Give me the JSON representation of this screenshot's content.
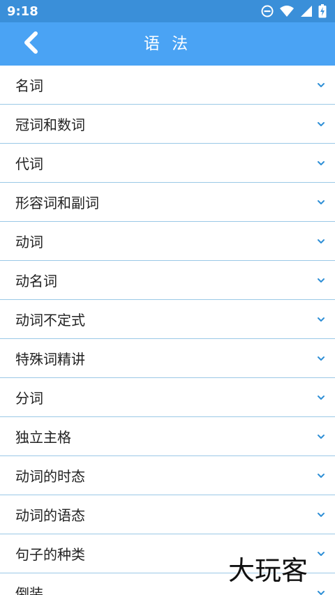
{
  "status_bar": {
    "time": "9:18",
    "icons": [
      "do-not-disturb-icon",
      "wifi-icon",
      "cellular-signal-icon",
      "battery-charging-icon"
    ]
  },
  "app_bar": {
    "title": "语 法",
    "back_icon": "chevron-left-icon"
  },
  "list": {
    "items": [
      {
        "label": "名词"
      },
      {
        "label": "冠词和数词"
      },
      {
        "label": "代词"
      },
      {
        "label": "形容词和副词"
      },
      {
        "label": "动词"
      },
      {
        "label": "动名词"
      },
      {
        "label": "动词不定式"
      },
      {
        "label": "特殊词精讲"
      },
      {
        "label": "分词"
      },
      {
        "label": "独立主格"
      },
      {
        "label": "动词的时态"
      },
      {
        "label": "动词的语态"
      },
      {
        "label": "句子的种类"
      },
      {
        "label": "倒装"
      }
    ],
    "expand_icon": "chevron-down-icon"
  },
  "watermark": {
    "text": "大玩客"
  },
  "colors": {
    "status_bar": "#3a8fd9",
    "app_bar": "#4aa3f4",
    "divider": "#9ac8e6",
    "chevron": "#2f8fd6",
    "text": "#222222"
  }
}
